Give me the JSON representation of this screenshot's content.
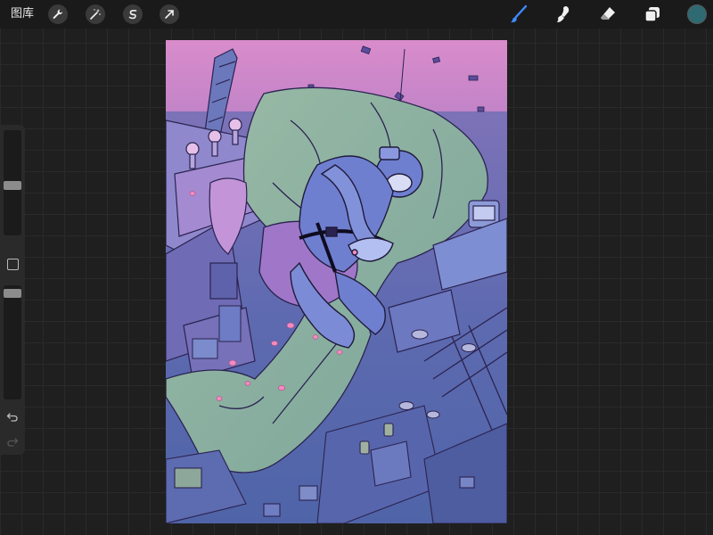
{
  "app": {
    "gallery_label": "图库"
  },
  "toolbar_left": [
    {
      "name": "wrench-icon",
      "action": "actions"
    },
    {
      "name": "magic-wand-icon",
      "action": "adjustments"
    },
    {
      "name": "selection-s-icon",
      "action": "selection"
    },
    {
      "name": "transform-arrow-icon",
      "action": "transform"
    }
  ],
  "toolbar_right": [
    {
      "name": "brush-icon",
      "active": true
    },
    {
      "name": "smudge-icon",
      "active": false
    },
    {
      "name": "eraser-icon",
      "active": false
    },
    {
      "name": "layers-icon",
      "active": false
    }
  ],
  "current_color": "#2f6a72",
  "sidebar": {
    "brush_size_level": 0.53,
    "opacity_level": 0.03
  },
  "canvas": {
    "artwork": "illustration"
  },
  "colors": {
    "accent_active": "#3f8cff",
    "sky_pink": "#d88ac4",
    "cloth_green": "#86ad9c",
    "deep_purple": "#5b4c9c"
  }
}
